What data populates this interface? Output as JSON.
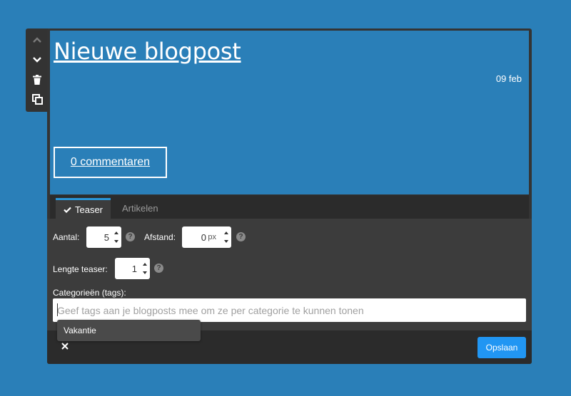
{
  "toolbar": {
    "icons": [
      "chevron-up-icon",
      "chevron-down-icon",
      "trash-icon",
      "duplicate-icon"
    ]
  },
  "preview": {
    "title": "Nieuwe blogpost",
    "date": "09 feb",
    "comments_label": "0 commentaren"
  },
  "tabs": [
    {
      "label": "Teaser",
      "active": true,
      "icon": "check-icon"
    },
    {
      "label": "Artikelen",
      "active": false
    }
  ],
  "settings": {
    "aantal": {
      "label": "Aantal:",
      "value": "5"
    },
    "afstand": {
      "label": "Afstand:",
      "value": "0",
      "unit": "px"
    },
    "lengte": {
      "label": "Lengte teaser:",
      "value": "1"
    },
    "help_glyph": "?",
    "categories": {
      "label": "Categorieën (tags):",
      "placeholder": "Geef tags aan je blogposts mee om ze per categorie te kunnen tonen",
      "suggestions": [
        "Vakantie"
      ]
    }
  },
  "footer": {
    "close_icon": "close-icon",
    "save_label": "Opslaan"
  },
  "colors": {
    "background": "#2a7fb8",
    "panel": "#3c3c3c",
    "dark": "#2b2b2b",
    "accent": "#2196f3"
  }
}
